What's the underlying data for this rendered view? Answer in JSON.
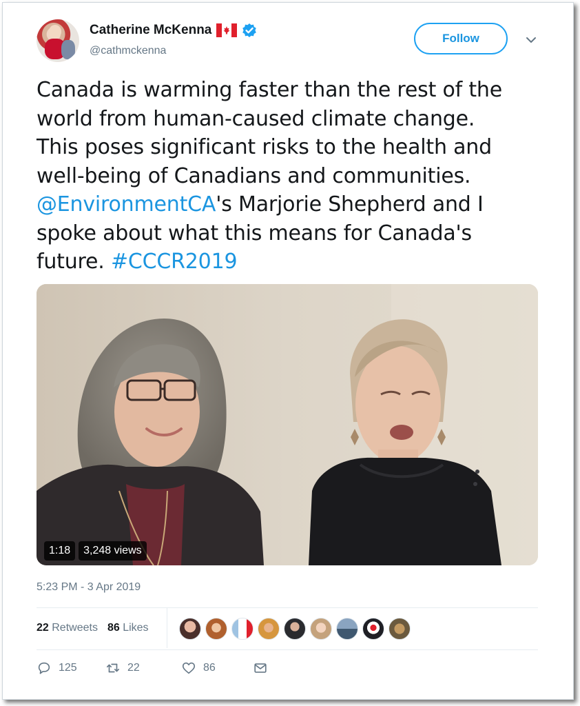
{
  "author": {
    "name": "Catherine McKenna",
    "handle": "@cathmckenna",
    "follow_label": "Follow"
  },
  "tweet": {
    "text_lines": [
      "Canada is warming faster than the rest of the",
      "world from human-caused climate change.",
      "This poses significant risks to the health and",
      "well-being of Canadians and communities."
    ],
    "mention": "@EnvironmentCA",
    "after_mention": "'s Marjorie Shepherd and I",
    "line6": "spoke about what this means for Canada's",
    "line7_prefix": "future. ",
    "hashtag": "#CCCR2019"
  },
  "video": {
    "duration": "1:18",
    "views": "3,248 views"
  },
  "timestamp": "5:23 PM - 3 Apr 2019",
  "stats": {
    "retweets_count": "22",
    "retweets_label": "Retweets",
    "likes_count": "86",
    "likes_label": "Likes"
  },
  "actions": {
    "replies": "125",
    "retweets": "22",
    "likes": "86"
  },
  "colors": {
    "link": "#1b95e0",
    "verified": "#1da1f2",
    "text_secondary": "#657786"
  }
}
